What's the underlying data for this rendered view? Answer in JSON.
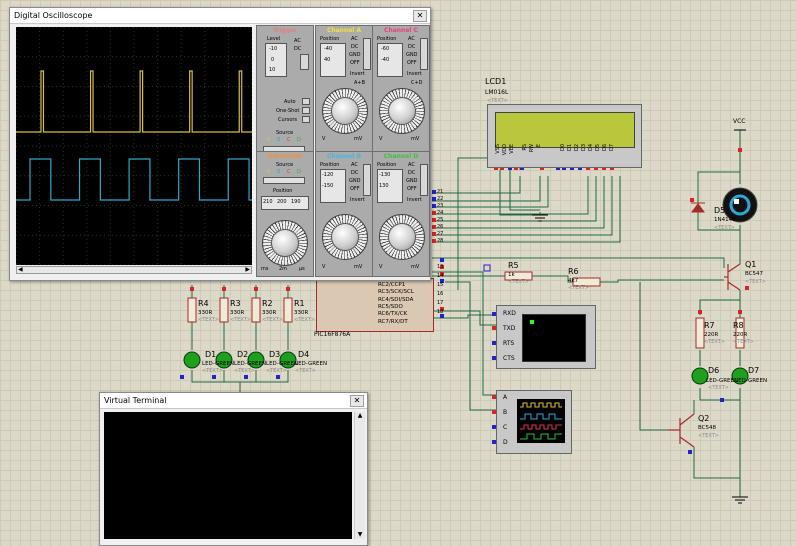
{
  "colors": {
    "wire": "#1f6a45",
    "component": "#a52a2a",
    "ch_a": "#d8c040",
    "ch_b": "#30a8c8",
    "ch_c": "#e03060",
    "ch_d": "#30b030",
    "led": "#1ea01e",
    "lcd": "#b8c83a"
  },
  "oscilloscope": {
    "title": "Digital Oscilloscope",
    "trigger": {
      "title": "Trigger",
      "level_label": "Level",
      "ac": "AC",
      "dc": "DC",
      "ticks": [
        "-10",
        "0",
        "10"
      ],
      "auto": "Auto",
      "one_shot": "One-Shot",
      "cursors": "Cursors",
      "source": "Source",
      "src_letters": [
        "A",
        "B",
        "C",
        "D"
      ]
    },
    "ch_a": {
      "title": "Channel A",
      "position": "Position",
      "ac": "AC",
      "dc": "DC",
      "gnd": "GND",
      "off": "OFF",
      "invert": "Invert",
      "apb": "A+B",
      "ticks": [
        "-40",
        "40",
        "60",
        "-50"
      ],
      "units": [
        "V",
        "mV"
      ]
    },
    "ch_c": {
      "title": "Channel C",
      "position": "Position",
      "ac": "AC",
      "dc": "DC",
      "gnd": "GND",
      "off": "OFF",
      "invert": "Invert",
      "cpd": "C+D",
      "ticks": [
        "-60",
        "-40",
        "40",
        "60"
      ],
      "units": [
        "V",
        "mV"
      ]
    },
    "horizontal": {
      "title": "Horizontal",
      "source": "Source",
      "src_letters": [
        "A",
        "B",
        "C",
        "D"
      ],
      "position": "Position",
      "pos_ticks": [
        "210",
        "200",
        "190"
      ],
      "units": [
        "ms",
        "μs"
      ],
      "readout": "2m"
    },
    "ch_b": {
      "title": "Channel B",
      "position": "Position",
      "ac": "AC",
      "dc": "DC",
      "gnd": "GND",
      "off": "OFF",
      "invert": "Invert",
      "ticks": [
        "-120",
        "-150",
        "150",
        "120"
      ],
      "units": [
        "V",
        "mV"
      ]
    },
    "ch_d": {
      "title": "Channel D",
      "position": "Position",
      "ac": "AC",
      "dc": "DC",
      "gnd": "GND",
      "off": "OFF",
      "invert": "Invert",
      "ticks": [
        "-130",
        "-130",
        "130",
        "130"
      ],
      "units": [
        "V",
        "mV"
      ]
    },
    "waveform": {
      "period_frac": 0.21,
      "a_duty": 0.05,
      "b_duty": 0.42
    }
  },
  "lcd": {
    "name": "LCD1",
    "model": "LM016L",
    "text": "<TEXT>",
    "pins": [
      "VSS",
      "VDD",
      "VEE",
      "RS",
      "RW",
      "E",
      "D0",
      "D1",
      "D2",
      "D3",
      "D4",
      "D5",
      "D6",
      "D7"
    ]
  },
  "mcu": {
    "name": "PIC16F876A",
    "pins_right": [
      "RC2/CCP1",
      "RC3/SCK/SCL",
      "RC4/SDI/SDA",
      "RC5/SDO",
      "RC6/TX/CK",
      "RC7/RX/DT"
    ],
    "pin_nums_top": [
      "21",
      "22",
      "23",
      "24",
      "25",
      "26",
      "27",
      "28"
    ],
    "pin_nums_right": [
      "13",
      "14",
      "15",
      "16",
      "17",
      "18"
    ]
  },
  "resistors": [
    {
      "name": "R4",
      "value": "330R",
      "text": "<TEXT>"
    },
    {
      "name": "R3",
      "value": "330R",
      "text": "<TEXT>"
    },
    {
      "name": "R2",
      "value": "330R",
      "text": "<TEXT>"
    },
    {
      "name": "R1",
      "value": "330R",
      "text": "<TEXT>"
    },
    {
      "name": "R5",
      "value": "1k",
      "text": "<TEXT>"
    },
    {
      "name": "R6",
      "value": "4k7",
      "text": "<TEXT>"
    },
    {
      "name": "R7",
      "value": "220R",
      "text": "<TEXT>"
    },
    {
      "name": "R8",
      "value": "220R",
      "text": "<TEXT>"
    }
  ],
  "leds": {
    "row_labels": [
      "D1",
      "D2",
      "D3",
      "D4"
    ],
    "row_text": "LED-GREEN",
    "d4_text": "LED-GREEN",
    "d6": "D6",
    "d7": "D7",
    "d7_text": "LED-GREEN",
    "tag": "<TEXT>"
  },
  "transistors": {
    "q1": "Q1",
    "q1_model": "BC547",
    "q2": "Q2",
    "q2_model": "BC548",
    "tag": "<TEXT>"
  },
  "diode": {
    "name": "D5",
    "model": "1N4148",
    "tag": "<TEXT>"
  },
  "vcc": "VCC",
  "serial": {
    "pins": [
      "RXD",
      "TXD",
      "RTS",
      "CTS"
    ]
  },
  "logic_analyzer": {
    "pins": [
      "A",
      "B",
      "C",
      "D"
    ]
  },
  "virtual_terminal": {
    "title": "Virtual Terminal",
    "close": "✕"
  }
}
